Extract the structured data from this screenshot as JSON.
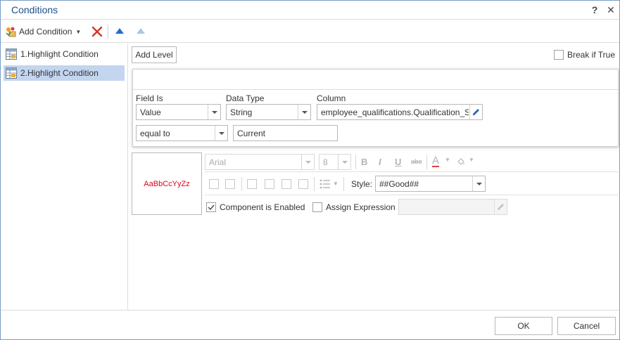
{
  "window": {
    "title": "Conditions",
    "help_glyph": "?",
    "close_glyph": "✕"
  },
  "toolbar": {
    "add_condition_label": "Add Condition",
    "icons": [
      "add-condition-icon",
      "delete-icon",
      "move-up-icon",
      "move-down-icon"
    ]
  },
  "conditions": [
    {
      "label": "1.Highlight Condition",
      "selected": false
    },
    {
      "label": "2.Highlight Condition",
      "selected": true
    }
  ],
  "level": {
    "add_level_label": "Add Level",
    "break_if_true_label": "Break if True",
    "break_if_true_checked": false,
    "field_is_label": "Field Is",
    "field_is_value": "Value",
    "data_type_label": "Data Type",
    "data_type_value": "String",
    "column_label": "Column",
    "column_value": "employee_qualifications.Qualification_S",
    "operator_value": "equal to",
    "compare_value": "Current"
  },
  "format": {
    "preview_text": "AaBbCcYyZz",
    "preview_color": "#e0001b",
    "font_family": "Arial",
    "font_size": "8",
    "bold_glyph": "B",
    "italic_glyph": "I",
    "underline_glyph": "U",
    "strike_glyph": "abc",
    "font_color_glyph": "A",
    "style_label": "Style:",
    "style_value": "##Good##",
    "component_enabled_label": "Component is Enabled",
    "component_enabled_checked": true,
    "assign_expression_label": "Assign Expression",
    "assign_expression_checked": false
  },
  "footer": {
    "ok_label": "OK",
    "cancel_label": "Cancel"
  },
  "colors": {
    "accent": "#1e4e8c",
    "selection": "#c3d5ef",
    "border": "#7a9cc6"
  }
}
